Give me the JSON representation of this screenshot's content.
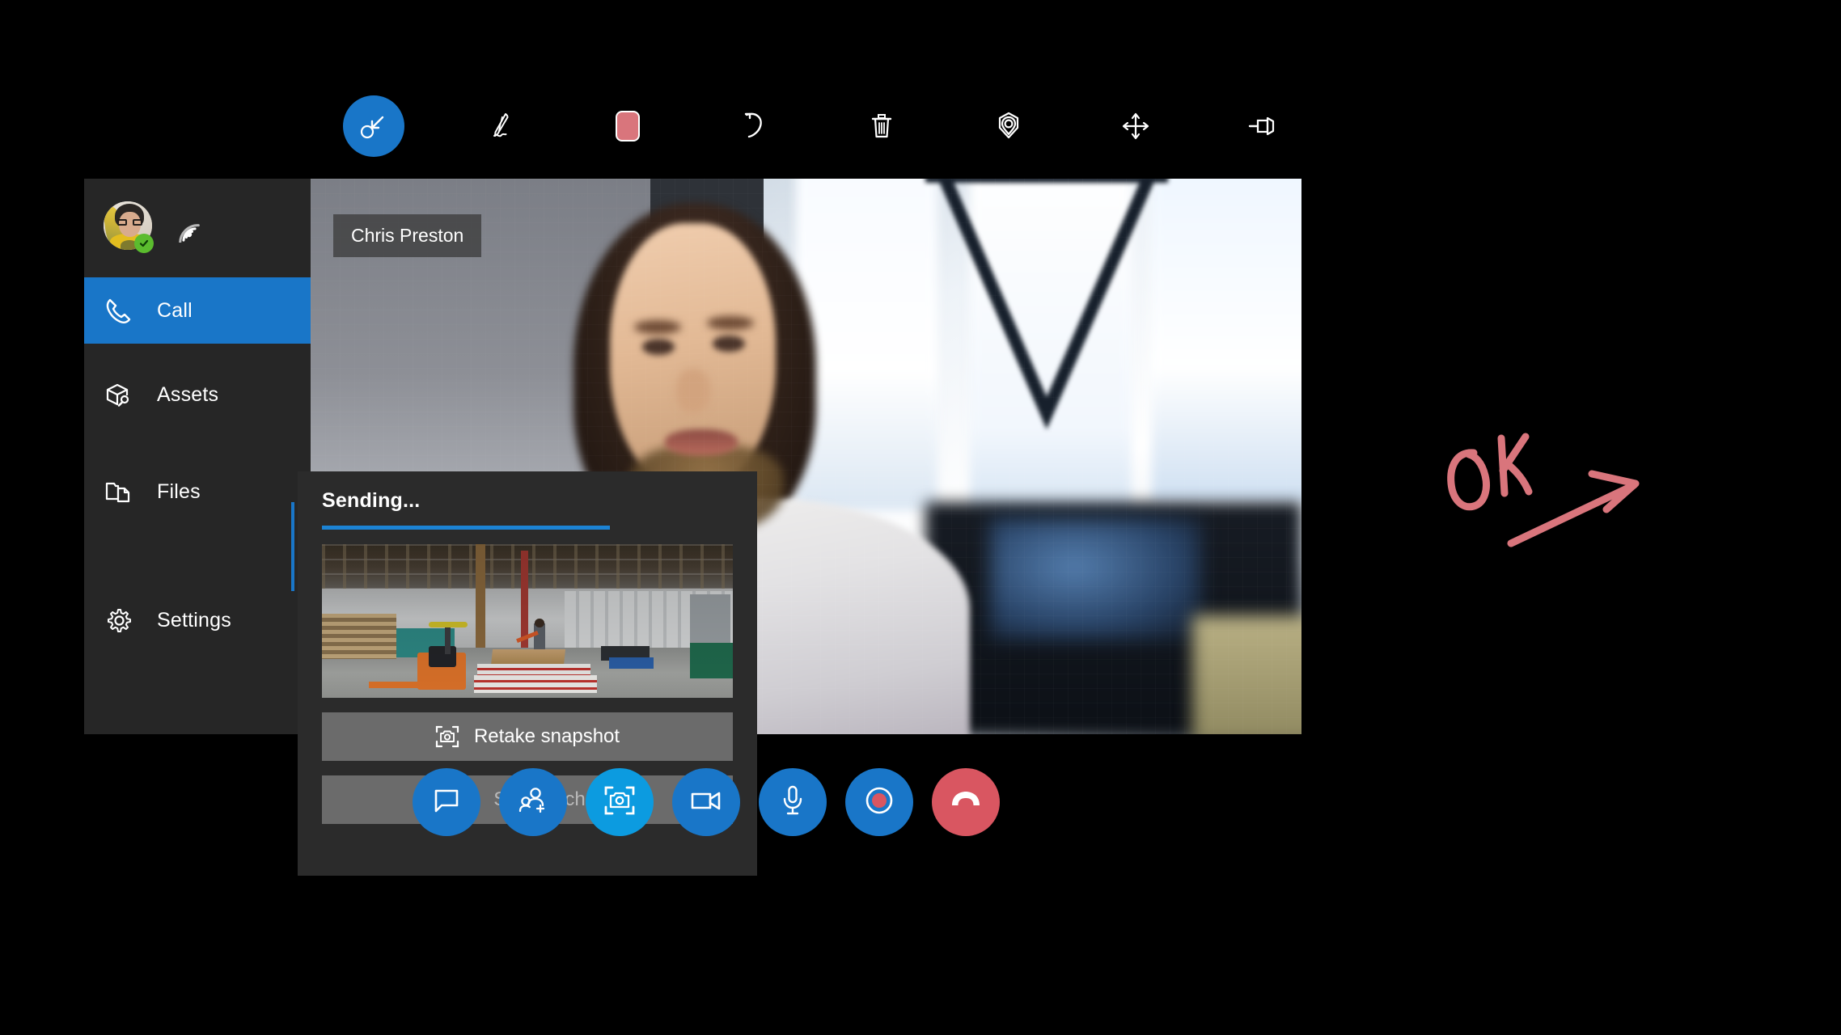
{
  "annotation_toolbar": {
    "tools": [
      {
        "id": "select",
        "label": "Select",
        "icon": "select-cursor-icon",
        "active": true
      },
      {
        "id": "ink",
        "label": "Ink",
        "icon": "pen-icon",
        "active": false
      },
      {
        "id": "color",
        "label": "Color",
        "icon": "color-swatch-icon",
        "active": false,
        "color": "#D9757C"
      },
      {
        "id": "undo",
        "label": "Undo",
        "icon": "undo-arrow-icon",
        "active": false
      },
      {
        "id": "delete",
        "label": "Delete",
        "icon": "trash-icon",
        "active": false
      },
      {
        "id": "anchor",
        "label": "Place anchor",
        "icon": "anchor-marker-icon",
        "active": false
      },
      {
        "id": "move",
        "label": "Move",
        "icon": "move-arrows-icon",
        "active": false
      },
      {
        "id": "pin",
        "label": "Pin",
        "icon": "pushpin-icon",
        "active": false
      }
    ]
  },
  "sidebar": {
    "user": {
      "presence": "available",
      "presence_icon": "green-check-badge",
      "avatar_icon": "user-avatar",
      "connection_icon": "wifi-signal-icon"
    },
    "items": [
      {
        "id": "call",
        "label": "Call",
        "icon": "phone-icon",
        "selected": true
      },
      {
        "id": "assets",
        "label": "Assets",
        "icon": "box-wrench-icon",
        "selected": false
      },
      {
        "id": "files",
        "label": "Files",
        "icon": "folder-file-icon",
        "selected": false
      },
      {
        "id": "settings",
        "label": "Settings",
        "icon": "gear-icon",
        "selected": false
      }
    ]
  },
  "video": {
    "participant_name": "Chris Preston"
  },
  "snapshot_panel": {
    "status_label": "Sending...",
    "progress_percent": 70,
    "thumbnail_alt": "warehouse-snapshot-thumbnail",
    "retake_button": {
      "label": "Retake snapshot",
      "icon": "camera-frame-icon",
      "enabled": true
    },
    "save_button": {
      "label": "Save to chat",
      "icon": "send-arrow-icon",
      "enabled": false
    }
  },
  "call_controls": [
    {
      "id": "chat",
      "label": "Chat",
      "icon": "chat-bubble-icon",
      "style": "primary"
    },
    {
      "id": "add-participant",
      "label": "Add participant",
      "icon": "add-person-icon",
      "style": "primary"
    },
    {
      "id": "snapshot",
      "label": "Snapshot",
      "icon": "camera-frame-icon",
      "style": "accent"
    },
    {
      "id": "video",
      "label": "Video",
      "icon": "video-camera-icon",
      "style": "primary"
    },
    {
      "id": "microphone",
      "label": "Microphone",
      "icon": "microphone-icon",
      "style": "primary"
    },
    {
      "id": "record",
      "label": "Record",
      "icon": "record-circle-icon",
      "style": "primary"
    },
    {
      "id": "end-call",
      "label": "End call",
      "icon": "hang-up-phone-icon",
      "style": "danger"
    }
  ],
  "ink_annotation": {
    "text": "OK",
    "shape": "arrow-right",
    "color": "#D9757C"
  },
  "colors": {
    "accent_blue": "#1976C8",
    "bright_blue": "#0C9BE0",
    "danger_red": "#D95661",
    "ink_salmon": "#D9757C",
    "presence_green": "#5BBC2E",
    "sidebar_bg": "#262626",
    "panel_bg": "#2B2B2B",
    "button_gray": "#6B6B6B"
  }
}
